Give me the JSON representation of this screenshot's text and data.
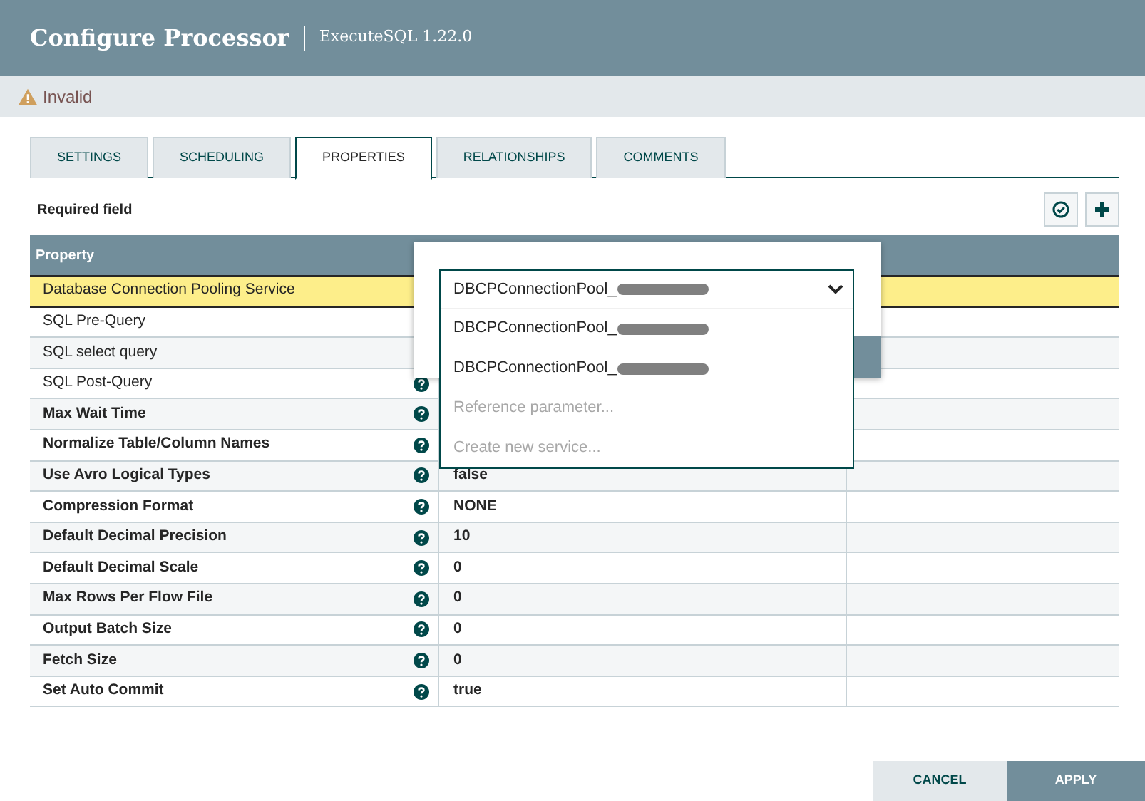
{
  "dialog": {
    "title": "Configure Processor",
    "subtitle": "ExecuteSQL 1.22.0"
  },
  "status": {
    "label": "Invalid"
  },
  "tabs": [
    {
      "label": "SETTINGS",
      "selected": false
    },
    {
      "label": "SCHEDULING",
      "selected": false
    },
    {
      "label": "PROPERTIES",
      "selected": true
    },
    {
      "label": "RELATIONSHIPS",
      "selected": false
    },
    {
      "label": "COMMENTS",
      "selected": false
    }
  ],
  "required_note": "Required field",
  "table": {
    "columns": [
      "Property"
    ],
    "rows": [
      {
        "name": "Database Connection Pooling Service",
        "required": false,
        "selected": true,
        "help": false
      },
      {
        "name": "SQL Pre-Query",
        "required": false,
        "selected": false,
        "help": false
      },
      {
        "name": "SQL select query",
        "required": false,
        "selected": false,
        "help": false
      },
      {
        "name": "SQL Post-Query",
        "required": false,
        "selected": false,
        "help": true
      },
      {
        "name": "Max Wait Time",
        "required": true,
        "selected": false,
        "help": true
      },
      {
        "name": "Normalize Table/Column Names",
        "required": true,
        "selected": false,
        "help": true
      },
      {
        "name": "Use Avro Logical Types",
        "required": true,
        "selected": false,
        "help": true,
        "value": "false"
      },
      {
        "name": "Compression Format",
        "required": true,
        "selected": false,
        "help": true,
        "value": "NONE"
      },
      {
        "name": "Default Decimal Precision",
        "required": true,
        "selected": false,
        "help": true,
        "value": "10"
      },
      {
        "name": "Default Decimal Scale",
        "required": true,
        "selected": false,
        "help": true,
        "value": "0"
      },
      {
        "name": "Max Rows Per Flow File",
        "required": true,
        "selected": false,
        "help": true,
        "value": "0"
      },
      {
        "name": "Output Batch Size",
        "required": true,
        "selected": false,
        "help": true,
        "value": "0"
      },
      {
        "name": "Fetch Size",
        "required": true,
        "selected": false,
        "help": true,
        "value": "0"
      },
      {
        "name": "Set Auto Commit",
        "required": true,
        "selected": false,
        "help": true,
        "value": "true"
      }
    ]
  },
  "dropdown": {
    "value": "DBCPConnectionPool_",
    "options": [
      {
        "label": "DBCPConnectionPool_",
        "disabled": false
      },
      {
        "label": "DBCPConnectionPool_",
        "disabled": false
      },
      {
        "label": "Reference parameter...",
        "disabled": true
      },
      {
        "label": "Create new service...",
        "disabled": true
      }
    ]
  },
  "buttons": [
    {
      "label": "CANCEL",
      "kind": "secondary"
    },
    {
      "label": "APPLY",
      "kind": "primary"
    }
  ]
}
